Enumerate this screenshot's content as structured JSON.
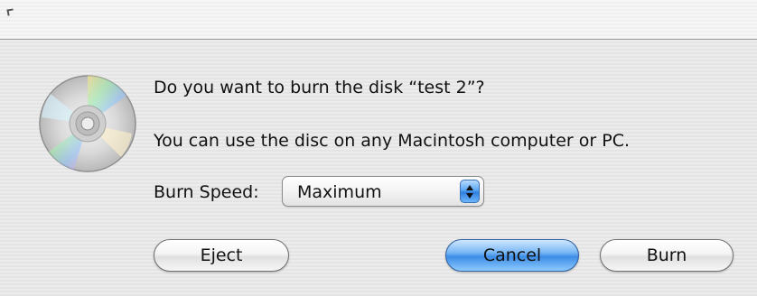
{
  "dialog": {
    "question": "Do you want to burn the disk “test 2”?",
    "info": "You can use the disc on any Macintosh computer or PC.",
    "burn_speed_label": "Burn Speed:",
    "burn_speed_value": "Maximum",
    "buttons": {
      "eject": "Eject",
      "cancel": "Cancel",
      "burn": "Burn"
    }
  },
  "icons": {
    "disc": "cd-disc-icon",
    "popup_arrows": "up-down-arrows-icon"
  },
  "colors": {
    "default_button": "#3d8de6",
    "background": "#ededed"
  }
}
